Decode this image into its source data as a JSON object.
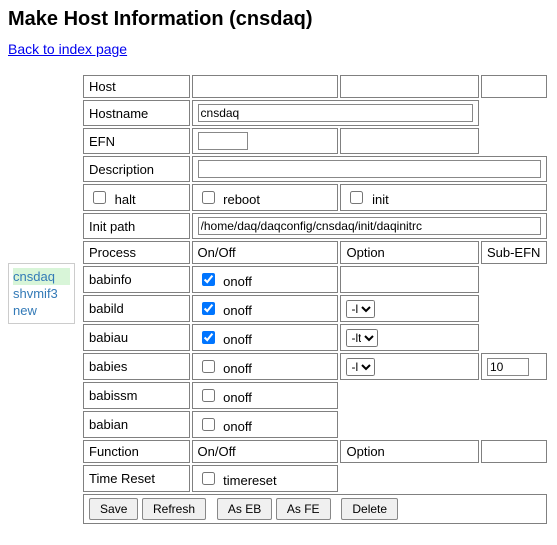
{
  "title": "Make Host Information (cnsdaq)",
  "back_link": "Back to index page",
  "sidebar": {
    "items": [
      {
        "label": "cnsdaq"
      },
      {
        "label": "shvmif3"
      },
      {
        "label": "new"
      }
    ]
  },
  "section_host": {
    "header": "Host"
  },
  "host": {
    "hostname_label": "Hostname",
    "hostname_value": "cnsdaq",
    "efn_label": "EFN",
    "efn_value": "",
    "desc_label": "Description",
    "desc_value": "",
    "halt_label": "halt",
    "reboot_label": "reboot",
    "init_label": "init",
    "initpath_label": "Init path",
    "initpath_value": "/home/daq/daqconfig/cnsdaq/init/daqinitrc"
  },
  "section_proc": {
    "header": "Process",
    "onoff": "On/Off",
    "option": "Option",
    "subefn": "Sub-EFN"
  },
  "proc": {
    "rows": [
      {
        "name": "babinfo",
        "onoff_checked": true,
        "onoff_label": "onoff",
        "option_type": "none"
      },
      {
        "name": "babild",
        "onoff_checked": true,
        "onoff_label": "onoff",
        "option_type": "select",
        "option_value": "-l"
      },
      {
        "name": "babiau",
        "onoff_checked": true,
        "onoff_label": "onoff",
        "option_type": "select",
        "option_value": "-lt"
      },
      {
        "name": "babies",
        "onoff_checked": false,
        "onoff_label": "onoff",
        "option_type": "select",
        "option_value": "-l",
        "subefn": "10"
      },
      {
        "name": "babissm",
        "onoff_checked": false,
        "onoff_label": "onoff",
        "option_type": "none"
      },
      {
        "name": "babian",
        "onoff_checked": false,
        "onoff_label": "onoff",
        "option_type": "none"
      }
    ]
  },
  "section_func": {
    "header": "Function",
    "onoff": "On/Off",
    "option": "Option"
  },
  "func": {
    "rows": [
      {
        "name": "Time Reset",
        "onoff_checked": false,
        "onoff_label": "timereset"
      }
    ]
  },
  "buttons": {
    "save": "Save",
    "refresh": "Refresh",
    "as_eb": "As EB",
    "as_fe": "As FE",
    "delete": "Delete"
  }
}
